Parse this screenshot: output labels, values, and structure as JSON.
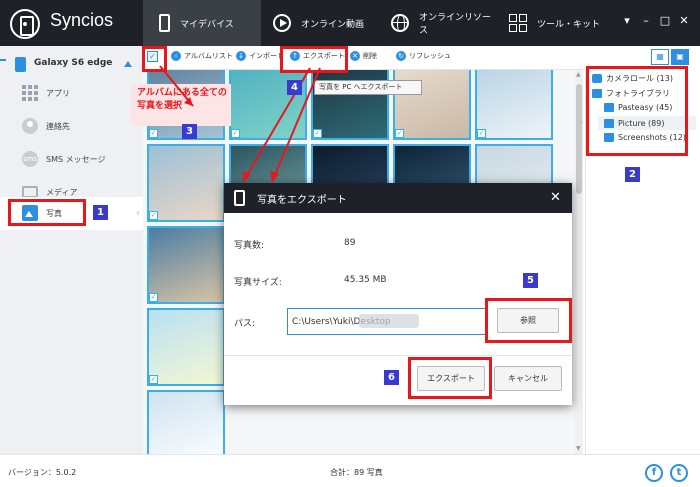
{
  "app": {
    "name": "Syncios"
  },
  "nav": {
    "tabs": [
      {
        "label": "マイデバイス",
        "icon": "phone-icon"
      },
      {
        "label": "オンライン動画",
        "icon": "play-icon"
      },
      {
        "label": "オンラインリソース",
        "icon": "globe-icon"
      },
      {
        "label": "ツール・キット",
        "icon": "grid-icon"
      }
    ],
    "window_buttons": [
      "▾",
      "–",
      "□",
      "✕"
    ]
  },
  "sidebar": {
    "device": "Galaxy S6 edge",
    "items": [
      {
        "label": "アプリ",
        "icon": "apps-icon"
      },
      {
        "label": "連絡先",
        "icon": "contact-icon"
      },
      {
        "label": "SMS メッセージ",
        "icon": "sms-icon",
        "icon_text": "sms"
      },
      {
        "label": "メディア",
        "icon": "media-icon"
      },
      {
        "label": "写真",
        "icon": "photo-icon",
        "active": true
      }
    ]
  },
  "toolbar": {
    "album_list": "アルバムリスト",
    "import": "インポート",
    "export": "エクスポート",
    "delete": "削除",
    "refresh": "リフレッシュ",
    "tooltip": "写真を PC へエクスポート"
  },
  "albums": [
    {
      "label": "カメラロール (13)"
    },
    {
      "label": "フォトライブラリ"
    },
    {
      "label": "Pasteasy (45)"
    },
    {
      "label": "Picture (89)",
      "selected": true
    },
    {
      "label": "Screenshots (12)"
    }
  ],
  "dialog": {
    "title": "写真をエクスポート",
    "count_label": "写真数:",
    "count_value": "89",
    "size_label": "写真サイズ:",
    "size_value": "45.35 MB",
    "path_label": "パス:",
    "path_value": "C:\\Users\\Yuki\\Desktop",
    "browse": "参照",
    "export": "エクスポート",
    "cancel": "キャンセル"
  },
  "annotation": {
    "tip": "アルバムにある全ての写真を選択",
    "steps": [
      "1",
      "2",
      "3",
      "4",
      "5",
      "6"
    ]
  },
  "status": {
    "version": "バージョン：5.0.2",
    "total": "合計：89 写真"
  },
  "social": {
    "facebook": "f",
    "twitter": "t"
  },
  "colors": {
    "accent": "#2d8fe0",
    "topbar": "#1e2228",
    "annotation": "#e8171b",
    "badge": "#3a3ad0",
    "thumb_border": "#3ab0e8"
  },
  "photos": [
    {
      "c1": "#5b7e9a",
      "c2": "#a7c4d4"
    },
    {
      "c1": "#4fb0c2",
      "c2": "#7fd3c8"
    },
    {
      "c1": "#1c3440",
      "c2": "#2f6b77"
    },
    {
      "c1": "#e8ddd0",
      "c2": "#c9b8a6"
    },
    {
      "c1": "#b7d2e4",
      "c2": "#eef4f8"
    },
    {
      "c1": "#9cc0d6",
      "c2": "#e9d7c7"
    },
    {
      "c1": "#2b5560",
      "c2": "#7ba8a8"
    },
    {
      "c1": "#0c1b2c",
      "c2": "#2e4c6b"
    },
    {
      "c1": "#0e2437",
      "c2": "#38607e"
    },
    {
      "c1": "#c8d8e2",
      "c2": "#e9eef1"
    },
    {
      "c1": "#4b7da3",
      "c2": "#d8c4a6"
    },
    {
      "c1": "#c25b3b",
      "c2": "#7b5ca0"
    },
    {
      "c1": "#f6b98a",
      "c2": "#c8d4e8"
    },
    {
      "c1": "#2c4b6a",
      "c2": "#d9cfb9"
    },
    {
      "c1": "#e6c5a0",
      "c2": "#a8b8c8"
    },
    {
      "c1": "#b9e0f2",
      "c2": "#f4f7d4"
    },
    {
      "c1": "#1d3a26",
      "c2": "#f2d044"
    },
    {
      "c1": "#e9eef3",
      "c2": "#c3d3e0"
    },
    {
      "c1": "#14110c",
      "c2": "#6b5a3c"
    },
    {
      "c1": "#c7d9e6",
      "c2": "#f2f5f7"
    }
  ]
}
